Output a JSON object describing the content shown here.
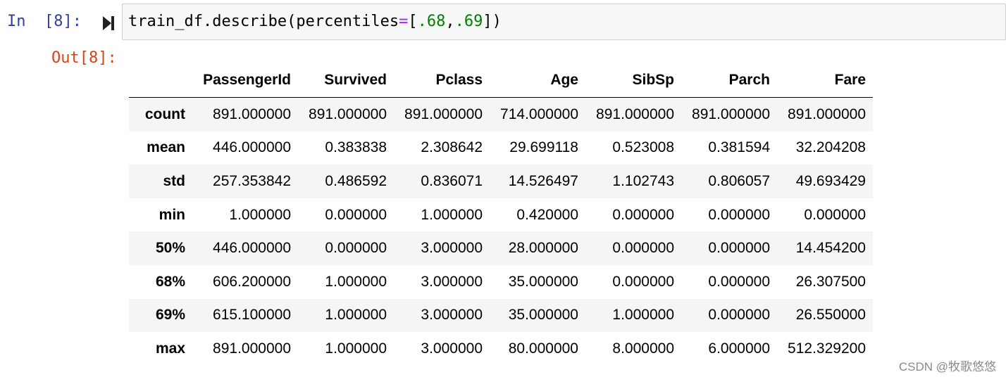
{
  "cell": {
    "in_prompt": "In  [8]:",
    "out_prompt": "Out[8]:",
    "code": {
      "fn": "train_df.describe(percentiles",
      "eq": "=",
      "open_bracket": "[",
      "p1": ".68",
      "comma": ",",
      "p2": ".69",
      "close": "])"
    }
  },
  "table": {
    "columns": [
      "",
      "PassengerId",
      "Survived",
      "Pclass",
      "Age",
      "SibSp",
      "Parch",
      "Fare"
    ],
    "rows": [
      {
        "label": "count",
        "values": [
          "891.000000",
          "891.000000",
          "891.000000",
          "714.000000",
          "891.000000",
          "891.000000",
          "891.000000"
        ]
      },
      {
        "label": "mean",
        "values": [
          "446.000000",
          "0.383838",
          "2.308642",
          "29.699118",
          "0.523008",
          "0.381594",
          "32.204208"
        ]
      },
      {
        "label": "std",
        "values": [
          "257.353842",
          "0.486592",
          "0.836071",
          "14.526497",
          "1.102743",
          "0.806057",
          "49.693429"
        ]
      },
      {
        "label": "min",
        "values": [
          "1.000000",
          "0.000000",
          "1.000000",
          "0.420000",
          "0.000000",
          "0.000000",
          "0.000000"
        ]
      },
      {
        "label": "50%",
        "values": [
          "446.000000",
          "0.000000",
          "3.000000",
          "28.000000",
          "0.000000",
          "0.000000",
          "14.454200"
        ]
      },
      {
        "label": "68%",
        "values": [
          "606.200000",
          "1.000000",
          "3.000000",
          "35.000000",
          "0.000000",
          "0.000000",
          "26.307500"
        ]
      },
      {
        "label": "69%",
        "values": [
          "615.100000",
          "1.000000",
          "3.000000",
          "35.000000",
          "1.000000",
          "0.000000",
          "26.550000"
        ]
      },
      {
        "label": "max",
        "values": [
          "891.000000",
          "1.000000",
          "3.000000",
          "80.000000",
          "8.000000",
          "6.000000",
          "512.329200"
        ]
      }
    ]
  },
  "watermark": "CSDN @牧歌悠悠",
  "icons": {
    "run": "run-cell-icon"
  },
  "colors": {
    "in_prompt": "#303f9f",
    "out_prompt": "#d84315",
    "operator": "#aa22ff",
    "number": "#008000",
    "cell_background": "#f7f7f7",
    "cell_border": "#cfcfcf",
    "row_stripe": "#f5f5f5"
  }
}
